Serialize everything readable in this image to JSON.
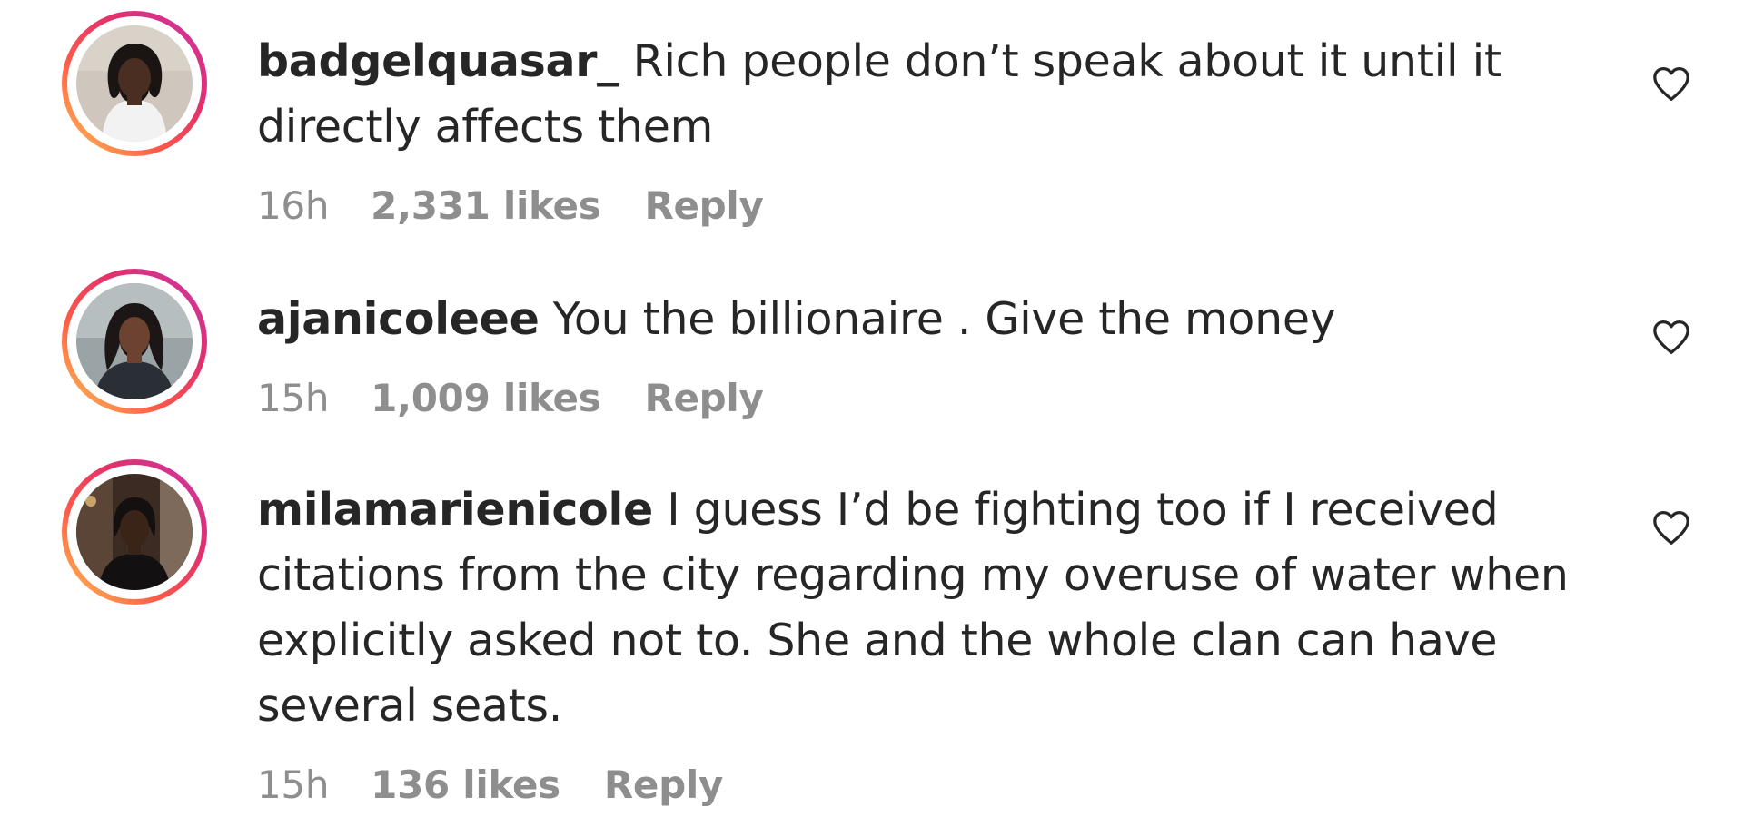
{
  "comments": [
    {
      "username": "badgelquasar_",
      "text": "Rich people don’t speak about it until it directly affects them",
      "time": "16h",
      "likes": "2,331 likes",
      "reply": "Reply",
      "avatar": "avatar-photo",
      "like_icon": "heart-outline-icon"
    },
    {
      "username": "ajanicoleee",
      "text": "You the billionaire . Give the money",
      "time": "15h",
      "likes": "1,009 likes",
      "reply": "Reply",
      "avatar": "avatar-photo",
      "like_icon": "heart-outline-icon"
    },
    {
      "username": "milamarienicole",
      "text": "I guess I’d be fighting too if I received citations from the city regarding my overuse of water when explicitly asked not to. She and the whole clan can have several seats.",
      "time": "15h",
      "likes": "136 likes",
      "reply": "Reply",
      "avatar": "avatar-photo",
      "like_icon": "heart-outline-icon"
    }
  ],
  "colors": {
    "text": "#262626",
    "meta": "#8e8e8e",
    "ring_start": "#c837ab",
    "ring_end": "#fdcb52"
  }
}
